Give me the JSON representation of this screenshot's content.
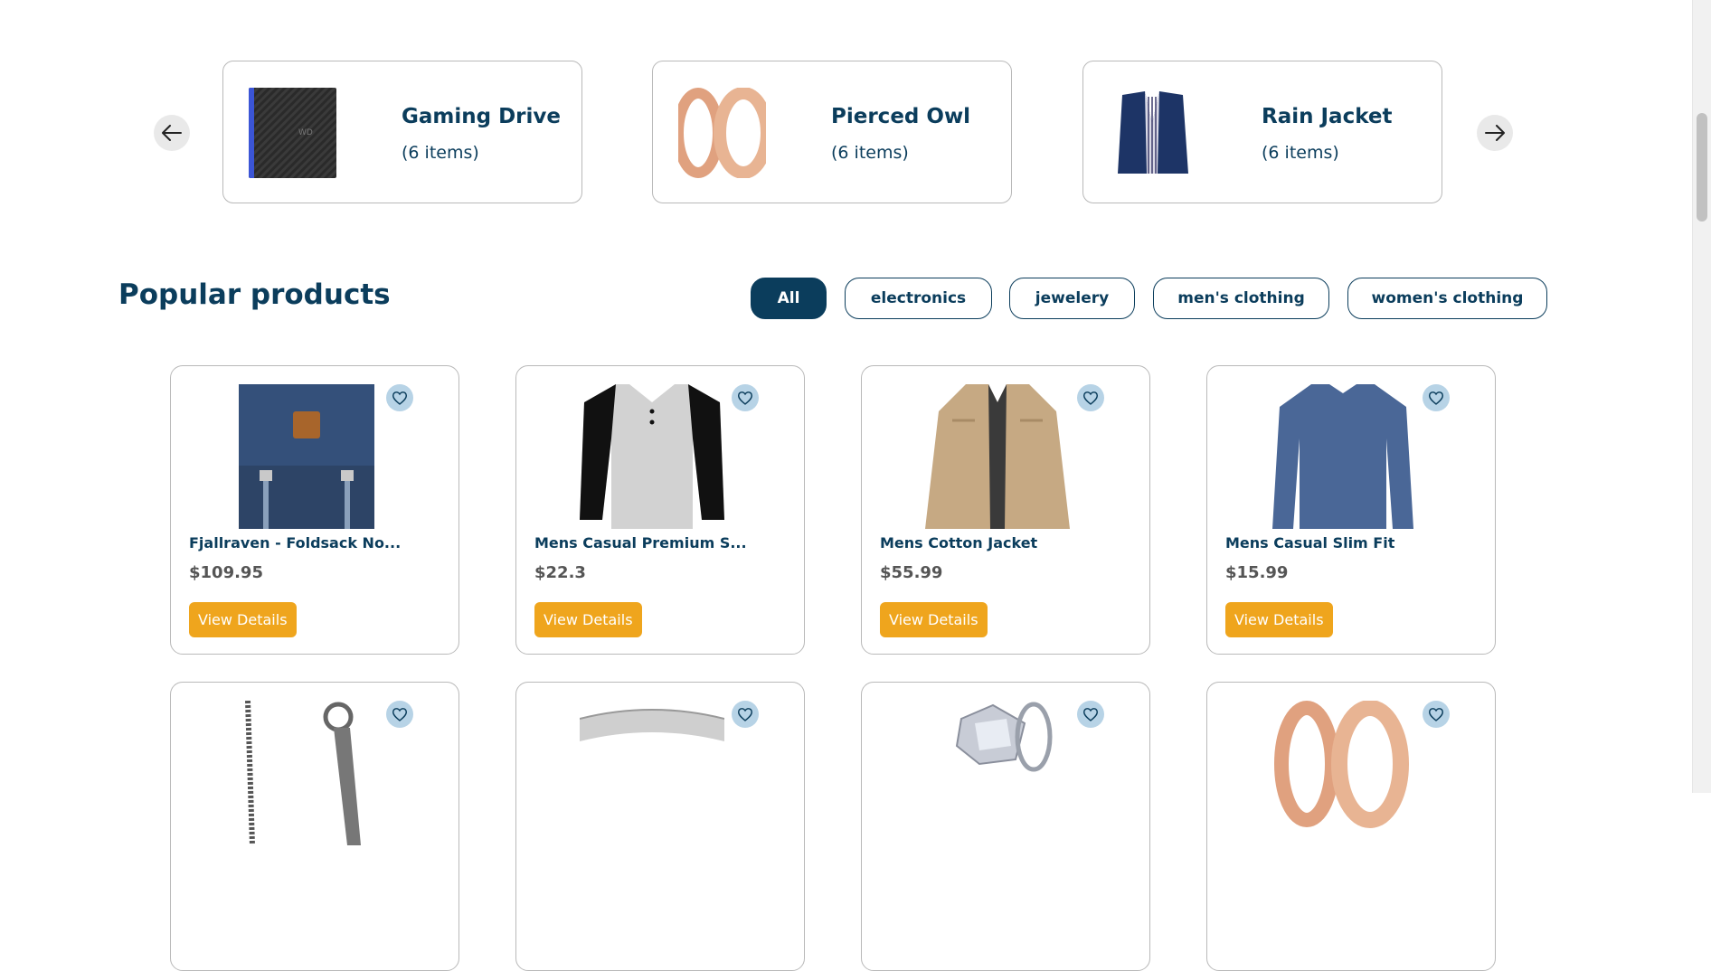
{
  "carousel": {
    "items": [
      {
        "title": "Gaming Drive",
        "count": "(6 items)",
        "icon": "hard-drive-image"
      },
      {
        "title": "Pierced Owl",
        "count": "(6 items)",
        "icon": "rings-image"
      },
      {
        "title": "Rain Jacket",
        "count": "(6 items)",
        "icon": "jacket-image"
      }
    ],
    "prev_icon": "arrow-left-icon",
    "next_icon": "arrow-right-icon"
  },
  "popular": {
    "title": "Popular products",
    "filters": [
      "All",
      "electronics",
      "jewelery",
      "men's clothing",
      "women's clothing"
    ],
    "active_filter": "All"
  },
  "products": [
    {
      "title": "Fjallraven - Foldsack No...",
      "price": "$109.95",
      "button": "View Details"
    },
    {
      "title": "Mens Casual Premium S...",
      "price": "$22.3",
      "button": "View Details"
    },
    {
      "title": "Mens Cotton Jacket",
      "price": "$55.99",
      "button": "View Details"
    },
    {
      "title": "Mens Casual Slim Fit",
      "price": "$15.99",
      "button": "View Details"
    }
  ],
  "colors": {
    "primary": "#0b3d5c",
    "accent": "#efa51d",
    "fav_bg": "#b7d3e6",
    "border": "#b9b9b9"
  }
}
